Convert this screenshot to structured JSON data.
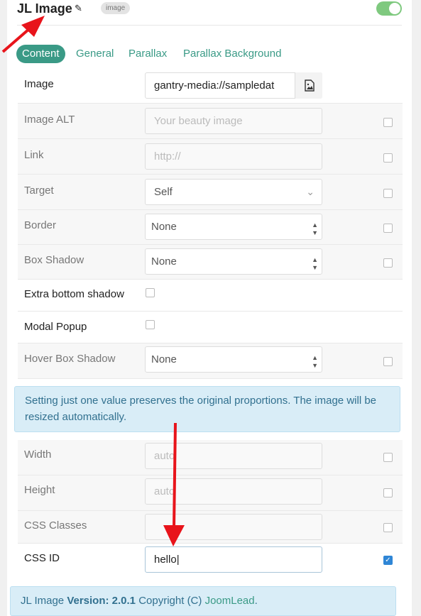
{
  "header": {
    "title": "JL Image",
    "type_badge": "image",
    "enabled": true
  },
  "tabs": [
    {
      "label": "Content",
      "active": true
    },
    {
      "label": "General",
      "active": false
    },
    {
      "label": "Parallax",
      "active": false
    },
    {
      "label": "Parallax Background",
      "active": false
    }
  ],
  "fields": {
    "image": {
      "label": "Image",
      "value": "gantry-media://sampledat"
    },
    "image_alt": {
      "label": "Image ALT",
      "placeholder": "Your beauty image"
    },
    "link": {
      "label": "Link",
      "placeholder": "http://"
    },
    "target": {
      "label": "Target",
      "value": "Self"
    },
    "border": {
      "label": "Border",
      "value": "None"
    },
    "box_shadow": {
      "label": "Box Shadow",
      "value": "None"
    },
    "extra_bottom_shadow": {
      "label": "Extra bottom shadow",
      "checked": false
    },
    "modal_popup": {
      "label": "Modal Popup",
      "checked": false
    },
    "hover_box_shadow": {
      "label": "Hover Box Shadow",
      "value": "None"
    },
    "width": {
      "label": "Width",
      "placeholder": "auto"
    },
    "height": {
      "label": "Height",
      "placeholder": "auto"
    },
    "css_classes": {
      "label": "CSS Classes",
      "value": ""
    },
    "css_id": {
      "label": "CSS ID",
      "value": "hello",
      "override_checked": true
    }
  },
  "notice": {
    "text": "Setting just one value preserves the original proportions. The image will be resized automatically."
  },
  "footer": {
    "prefix": "JL Image ",
    "version_label": "Version: 2.0.1",
    "copyright": " Copyright (C) ",
    "vendor_link": "JoomLead",
    "suffix": "."
  },
  "colors": {
    "accent": "#3a9a86",
    "toggle_on": "#7fc97f",
    "annotation_arrow": "#e8141b",
    "notice_bg": "#d9edf7",
    "notice_text": "#31708f"
  }
}
